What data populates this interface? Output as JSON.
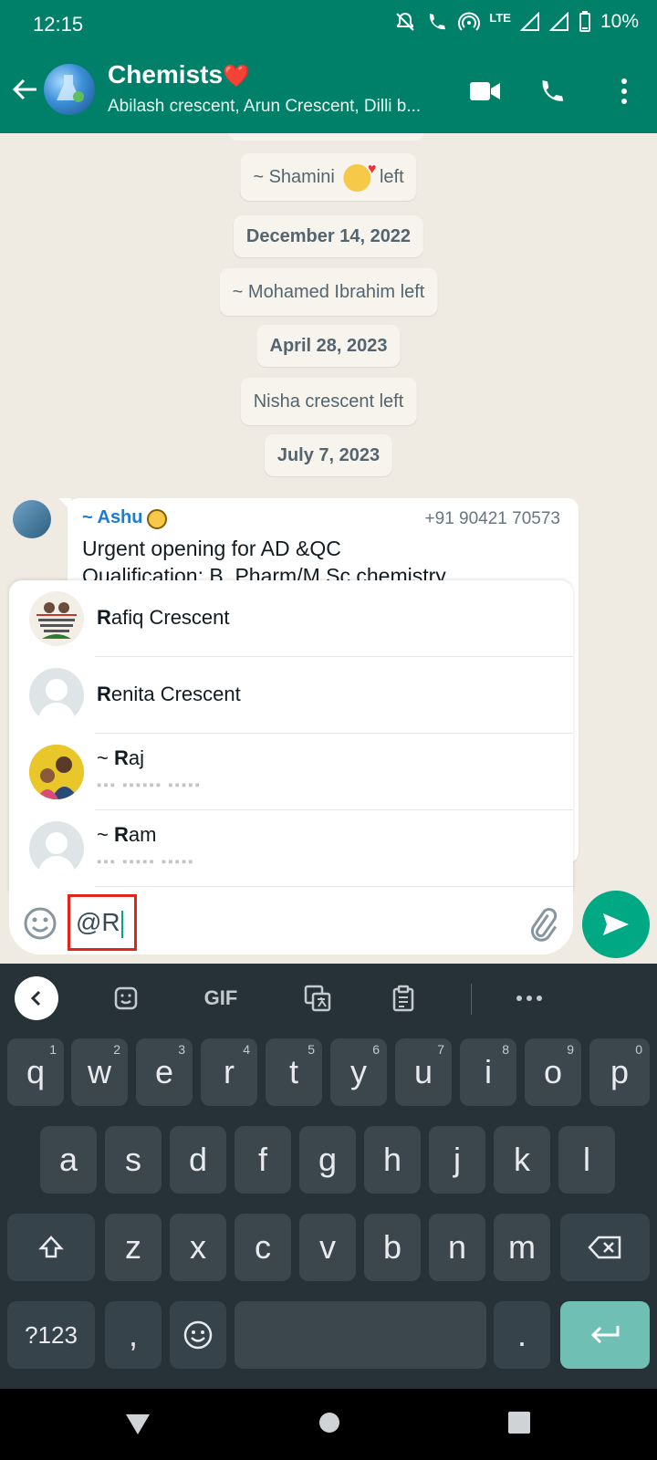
{
  "status_bar": {
    "time": "12:15",
    "network": "LTE",
    "battery": "10%"
  },
  "header": {
    "title": "Chemists",
    "title_emoji": "❤️",
    "subtitle": "Abilash crescent, Arun Crescent, Dilli b..."
  },
  "chat": {
    "events": [
      {
        "type": "system",
        "text_prefix": "~ Shamini",
        "text_suffix": "left"
      },
      {
        "type": "date",
        "text": "December 14, 2022"
      },
      {
        "type": "system",
        "text": "~ Mohamed Ibrahim left"
      },
      {
        "type": "date",
        "text": "April 28, 2023"
      },
      {
        "type": "system",
        "text": "Nisha crescent left"
      },
      {
        "type": "date",
        "text": "July 7, 2023"
      }
    ],
    "message": {
      "sender": "~ Ashu",
      "phone": "+91 90421 70573",
      "line1": "Urgent opening for AD &QC",
      "line2": "Qualification: B. Pharm/M.Sc chemistry"
    }
  },
  "mentions": [
    {
      "bold": "R",
      "rest": "afiq Crescent",
      "prefix": "",
      "sub": "",
      "avatar_caption": "Brother & Sister Is The Most Beautiful And Pure Relationship On The Earth"
    },
    {
      "bold": "R",
      "rest": "enita Crescent",
      "prefix": "",
      "sub": ""
    },
    {
      "bold": "R",
      "rest": "aj",
      "prefix": "~ ",
      "sub": "▪▪▪ ▪▪▪▪▪▪ ▪▪▪▪▪"
    },
    {
      "bold": "R",
      "rest": "am",
      "prefix": "~ ",
      "sub": "▪▪▪ ▪▪▪▪▪ ▪▪▪▪▪"
    }
  ],
  "composer": {
    "value": "@R"
  },
  "keyboard": {
    "toolbar": {
      "gif": "GIF"
    },
    "row1": [
      {
        "k": "q",
        "h": "1"
      },
      {
        "k": "w",
        "h": "2"
      },
      {
        "k": "e",
        "h": "3"
      },
      {
        "k": "r",
        "h": "4"
      },
      {
        "k": "t",
        "h": "5"
      },
      {
        "k": "y",
        "h": "6"
      },
      {
        "k": "u",
        "h": "7"
      },
      {
        "k": "i",
        "h": "8"
      },
      {
        "k": "o",
        "h": "9"
      },
      {
        "k": "p",
        "h": "0"
      }
    ],
    "row2": [
      "a",
      "s",
      "d",
      "f",
      "g",
      "h",
      "j",
      "k",
      "l"
    ],
    "row3": [
      "z",
      "x",
      "c",
      "v",
      "b",
      "n",
      "m"
    ],
    "symbols": "?123",
    "comma": ",",
    "period": "."
  },
  "colors": {
    "header": "#008069",
    "accent": "#00a884",
    "mention_link": "#1f7bd1",
    "keyboard_bg": "#263238"
  }
}
